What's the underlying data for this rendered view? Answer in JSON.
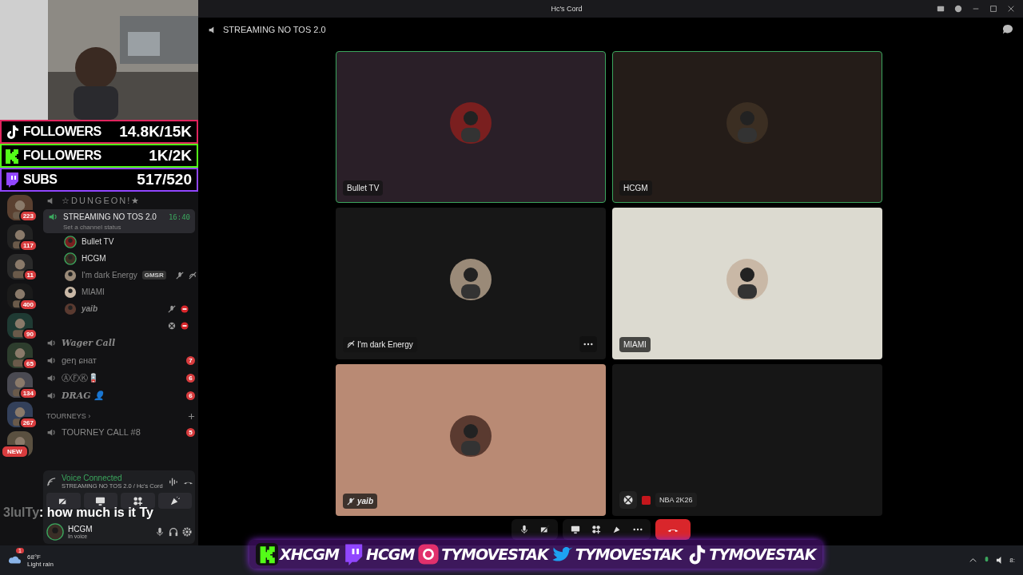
{
  "window": {
    "title": "Hc's Cord"
  },
  "stream_stats": [
    {
      "kind": "tiktok",
      "label": "FOLLOWERS",
      "value": "14.8K/15K",
      "color": "#e0245e"
    },
    {
      "kind": "kick",
      "label": "FOLLOWERS",
      "value": "1K/2K",
      "color": "#53fc18"
    },
    {
      "kind": "twitch",
      "label": "SUBS",
      "value": "517/520",
      "color": "#9146ff"
    }
  ],
  "servers": [
    {
      "badge": "223"
    },
    {
      "badge": "117"
    },
    {
      "badge": "11"
    },
    {
      "badge": "400"
    },
    {
      "badge": "90"
    },
    {
      "badge": "65"
    },
    {
      "badge": "134"
    },
    {
      "badge": "267"
    },
    {
      "badge": "NEW"
    }
  ],
  "channels_top": [
    {
      "name": "☆DUNGEON!★"
    }
  ],
  "active_channel": {
    "name": "STREAMING NO TOS 2.0",
    "time": "16:40",
    "status": "Set a channel status",
    "members": [
      {
        "kind": "user",
        "name": "Bullet TV",
        "speaking": true,
        "italic": false
      },
      {
        "kind": "user",
        "name": "HCGM",
        "speaking": true,
        "italic": false
      },
      {
        "kind": "user",
        "name": "I'm dark Energy",
        "speaking": false,
        "italic": false,
        "tag": "GMSR",
        "icons": [
          {
            "kind": "muted"
          },
          {
            "kind": "deafened"
          }
        ]
      },
      {
        "kind": "user",
        "name": "MIAMI",
        "speaking": false,
        "italic": false
      },
      {
        "kind": "user",
        "name": "yaib",
        "speaking": false,
        "italic": true,
        "icons": [
          {
            "kind": "muted"
          },
          {
            "kind": "live"
          }
        ]
      },
      {
        "kind": "device",
        "icons": [
          {
            "kind": "xbox"
          },
          {
            "kind": "live"
          }
        ]
      }
    ]
  },
  "channels": [
    {
      "kind": "voice",
      "name": "Wager Call",
      "fancy": true
    },
    {
      "kind": "voice",
      "name": "ɡеη ɕнат",
      "fancy": false,
      "badge": "7"
    },
    {
      "kind": "voice",
      "name": "ⒶⒻⓀ🪫",
      "fancy": false,
      "badge": "6"
    },
    {
      "kind": "voice",
      "name": "DRAG 👤",
      "fancy": true,
      "badge": "6"
    },
    {
      "kind": "category",
      "name": "TOURNEYS ›"
    },
    {
      "kind": "voice",
      "name": "TOURNEY CALL #8",
      "fancy": false,
      "badge": "5"
    }
  ],
  "voice_panel": {
    "status": "Voice Connected",
    "location": "STREAMING NO TOS 2.0 / Hc's Cord"
  },
  "user": {
    "name": "HCGM",
    "status": "In voice"
  },
  "chat_overlay": {
    "user": "3lulTy",
    "message": ": how much is it Ty"
  },
  "call": {
    "channel": "STREAMING NO TOS 2.0",
    "tiles": [
      {
        "kind": "user",
        "name": "Bullet TV",
        "speaking": true,
        "color": "#2a1f28"
      },
      {
        "kind": "user",
        "name": "HCGM",
        "speaking": true,
        "color": "#241c18"
      },
      {
        "kind": "user",
        "name": "I'm dark Energy",
        "speaking": false,
        "color": "#171717",
        "icons": [
          {
            "kind": "deafened"
          },
          {
            "kind": "more"
          }
        ]
      },
      {
        "kind": "user",
        "name": "MIAMI",
        "speaking": false,
        "color": "#dcdad0"
      },
      {
        "kind": "user",
        "name": "yaib",
        "speaking": false,
        "color": "#b98a74",
        "icons": [
          {
            "kind": "muted"
          }
        ]
      },
      {
        "kind": "game",
        "speaking": false,
        "color": "#161616",
        "game": "NBA 2K26"
      }
    ]
  },
  "socials": [
    {
      "kind": "kick",
      "handle": "XHCGM"
    },
    {
      "kind": "twitch",
      "handle": "HCGM"
    },
    {
      "kind": "instagram",
      "handle": "TYMOVESTAK"
    },
    {
      "kind": "twitter",
      "handle": "TYMOVESTAK"
    },
    {
      "kind": "tiktok",
      "handle": "TYMOVESTAK"
    }
  ],
  "taskbar": {
    "weather": "68°F",
    "condition": "Light rain",
    "badge": "1",
    "time": "8:"
  }
}
